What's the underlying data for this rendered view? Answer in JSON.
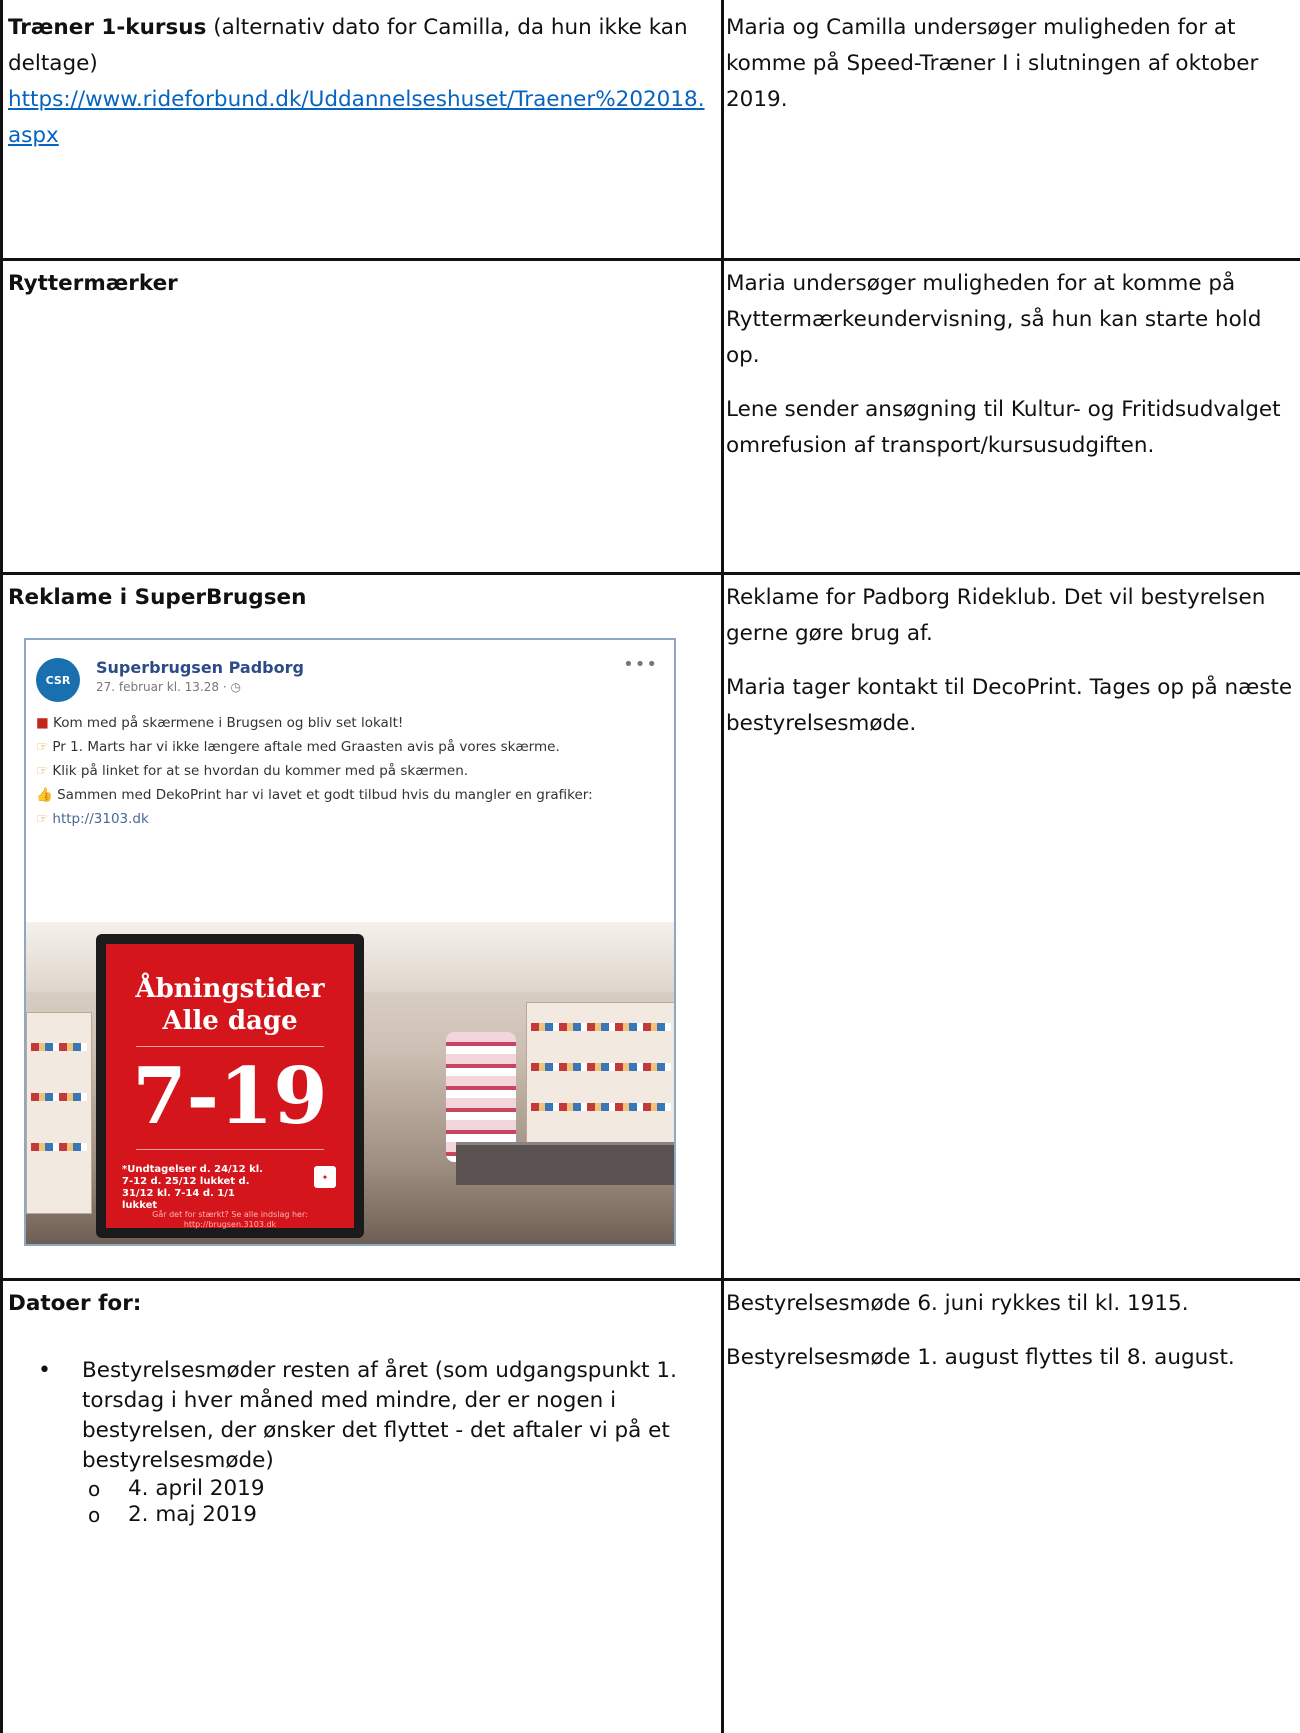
{
  "rows": [
    {
      "title": "Træner 1-kursus",
      "title_suffix": " (alternativ dato for Camilla, da hun ikke kan deltage)",
      "link_text": "https://www.rideforbund.dk/Uddannelseshuset/Traener%202018.aspx",
      "right_paragraphs": [
        "Maria og Camilla undersøger muligheden for at komme på Speed-Træner I i slutningen af oktober 2019."
      ]
    },
    {
      "title": "Ryttermærker",
      "right_paragraphs": [
        "Maria undersøger muligheden for at komme på Ryttermærkeundervisning, så hun kan starte hold op.",
        "Lene sender ansøgning til Kultur- og Fritidsudvalget omrefusion af transport/kursusudgiften."
      ]
    },
    {
      "title": "Reklame i SuperBrugsen",
      "right_paragraphs": [
        "Reklame for Padborg Rideklub. Det vil bestyrelsen gerne gøre brug af.",
        "Maria tager kontakt til DecoPrint. Tages op på næste bestyrelsesmøde."
      ],
      "post": {
        "avatar_text": "CSR",
        "page_name": "Superbrugsen Padborg",
        "time": "27. februar kl. 13.28 · ",
        "more": "•••",
        "lines": [
          "Kom med på skærmene i Brugsen og bliv set lokalt!",
          "Pr 1. Marts har vi ikke længere aftale med Graasten avis på vores skærme.",
          "Klik på linket for at se hvordan du kommer med på skærmen.",
          "Sammen med DekoPrint har vi lavet et godt tilbud hvis du mangler en grafiker:",
          "http://3103.dk"
        ],
        "sign": {
          "line1": "Åbningstider",
          "line2": "Alle dage",
          "hours": "7-19",
          "exceptions": "*Undtagelser d. 24/12 kl. 7-12 d. 25/12 lukket d. 31/12 kl. 7-14 d. 1/1 lukket",
          "footer": "Går det for stærkt? Se alle indslag her: http://brugsen.3103.dk"
        }
      }
    },
    {
      "title": "Datoer for:",
      "bullet": "Bestyrelsesmøder resten af året (som udgangspunkt 1. torsdag i hver måned med mindre, der er nogen i bestyrelsen, der ønsker det flyttet - det aftaler vi på et bestyrelsesmøde)",
      "sub_items": [
        "4. april 2019",
        "2. maj 2019"
      ],
      "right_paragraphs": [
        "Bestyrelsesmøde 6. juni rykkes til kl. 1915.",
        "Bestyrelsesmøde 1. august flyttes til 8. august."
      ]
    }
  ]
}
